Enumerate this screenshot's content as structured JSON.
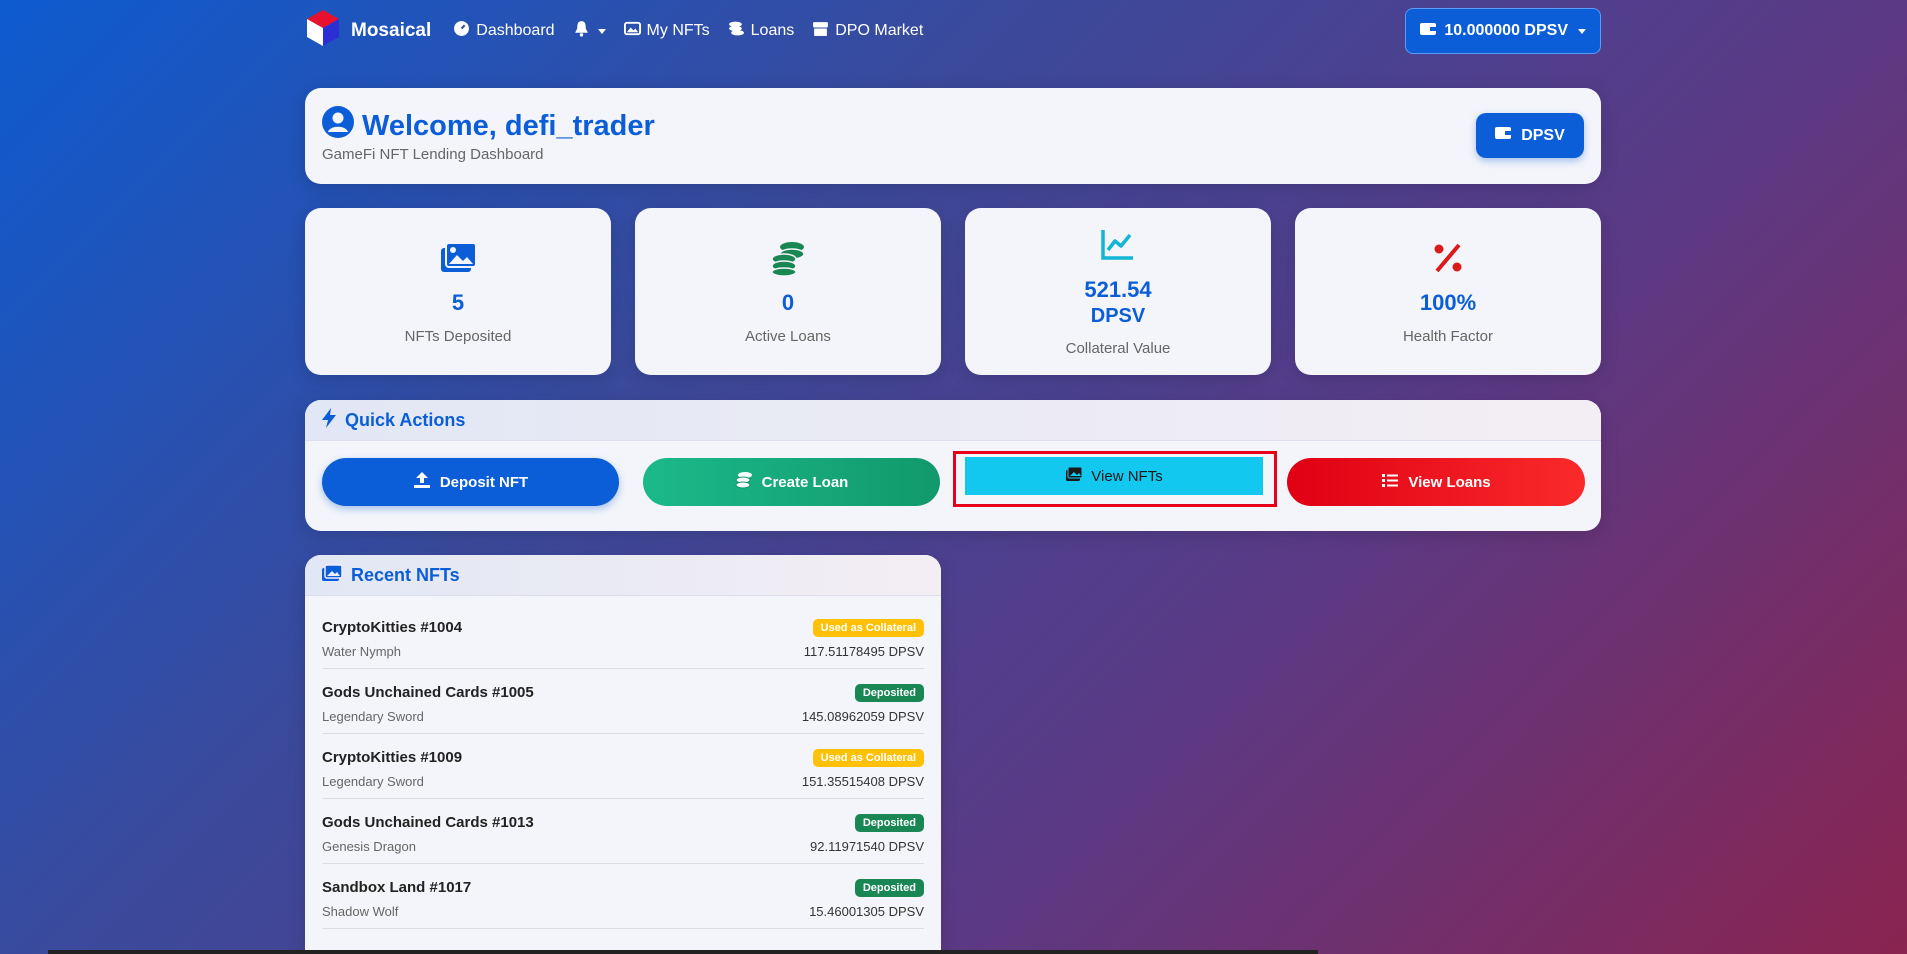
{
  "colors": {
    "primary": "#0b5ed7",
    "success": "#12996b",
    "info": "#12c8ee",
    "danger": "#e00014",
    "warning": "#ffc107"
  },
  "nav": {
    "brand": "Mosaical",
    "dashboard": "Dashboard",
    "my_nfts": "My NFTs",
    "loans": "Loans",
    "dpo_market": "DPO Market",
    "wallet_balance": "10.000000 DPSV"
  },
  "welcome": {
    "title": "Welcome, defi_trader",
    "subtitle": "GameFi NFT Lending Dashboard",
    "button": "DPSV"
  },
  "stats": [
    {
      "icon": "images-icon",
      "value": "5",
      "unit": "",
      "label": "NFTs Deposited",
      "color": "#0b5ed7"
    },
    {
      "icon": "coins-icon",
      "value": "0",
      "unit": "",
      "label": "Active Loans",
      "color": "#198754"
    },
    {
      "icon": "chart-line-icon",
      "value": "521.54",
      "unit": "DPSV",
      "label": "Collateral Value",
      "color": "#12b5d6"
    },
    {
      "icon": "percent-icon",
      "value": "100%",
      "unit": "",
      "label": "Health Factor",
      "color": "#dc1a1a"
    }
  ],
  "quick_actions": {
    "title": "Quick Actions",
    "deposit": "Deposit NFT",
    "create_loan": "Create Loan",
    "view_nfts": "View NFTs",
    "view_loans": "View Loans"
  },
  "recent": {
    "title": "Recent NFTs",
    "items": [
      {
        "name": "CryptoKitties #1004",
        "sub": "Water Nymph",
        "status": "Used as Collateral",
        "value": "117.51178495 DPSV"
      },
      {
        "name": "Gods Unchained Cards #1005",
        "sub": "Legendary Sword",
        "status": "Deposited",
        "value": "145.08962059 DPSV"
      },
      {
        "name": "CryptoKitties #1009",
        "sub": "Legendary Sword",
        "status": "Used as Collateral",
        "value": "151.35515408 DPSV"
      },
      {
        "name": "Gods Unchained Cards #1013",
        "sub": "Genesis Dragon",
        "status": "Deposited",
        "value": "92.11971540 DPSV"
      },
      {
        "name": "Sandbox Land #1017",
        "sub": "Shadow Wolf",
        "status": "Deposited",
        "value": "15.46001305 DPSV"
      }
    ]
  }
}
